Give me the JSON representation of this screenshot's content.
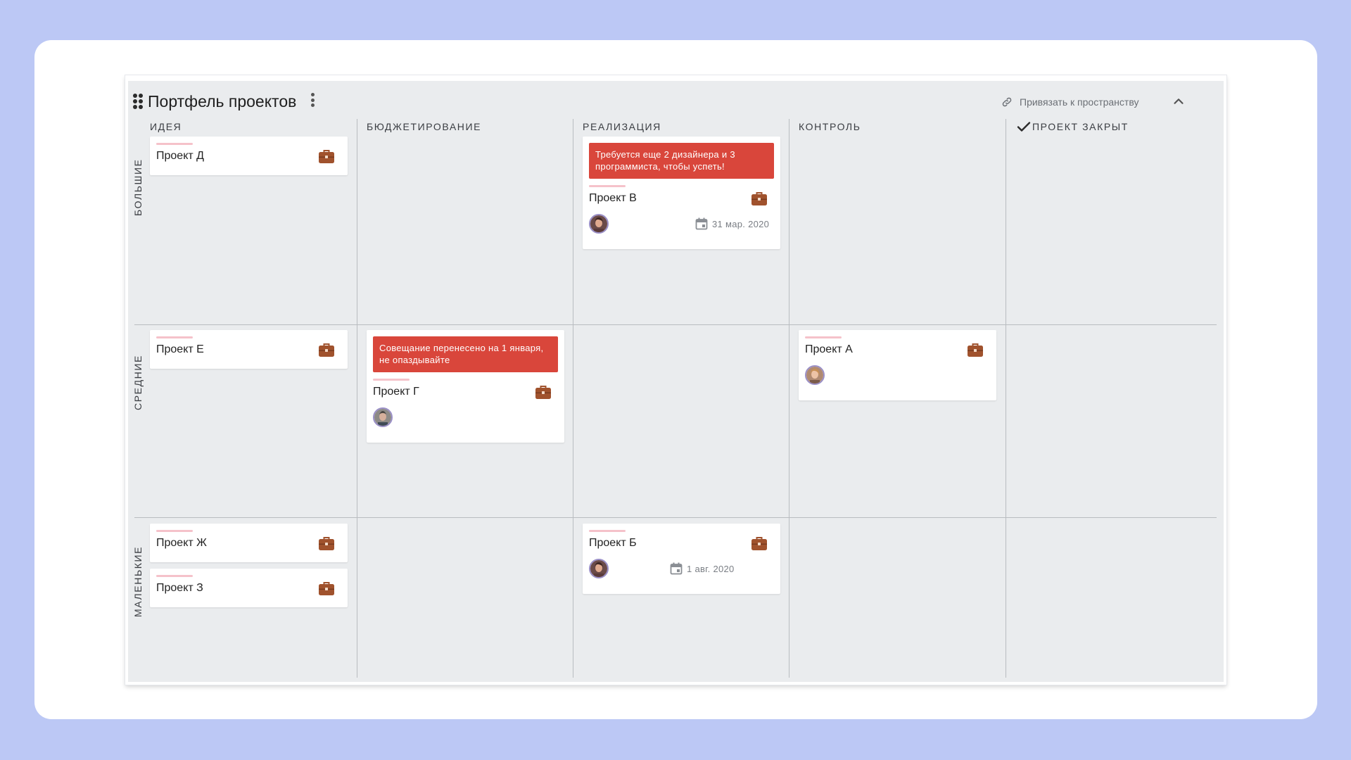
{
  "board": {
    "title": "Портфель проектов",
    "link_label": "Привязать к пространству"
  },
  "columns": [
    {
      "label": "ИДЕЯ"
    },
    {
      "label": "БЮДЖЕТИРОВАНИЕ"
    },
    {
      "label": "РЕАЛИЗАЦИЯ"
    },
    {
      "label": "КОНТРОЛЬ"
    },
    {
      "label": "ПРОЕКТ ЗАКРЫТ",
      "icon": "check-icon"
    }
  ],
  "rows": [
    {
      "label": "БОЛЬШИЕ"
    },
    {
      "label": "СРЕДНИЕ"
    },
    {
      "label": "МАЛЕНЬКИЕ"
    }
  ],
  "cards": {
    "d": {
      "title": "Проект Д"
    },
    "v": {
      "title": "Проект В",
      "alert": "Требуется еще 2 дизайнера и 3 программиста, чтобы успеть!",
      "due": "31 мар. 2020"
    },
    "e": {
      "title": "Проект Е"
    },
    "g": {
      "title": "Проект Г",
      "alert": "Совещание перенесено на 1 января, не опаздывайте"
    },
    "a": {
      "title": "Проект А"
    },
    "zh": {
      "title": "Проект Ж"
    },
    "z": {
      "title": "Проект З"
    },
    "b": {
      "title": "Проект Б",
      "due": "1 авг. 2020"
    }
  },
  "colors": {
    "background": "#bcc8f5",
    "board": "#eaecee",
    "alert": "#d9463b",
    "priority_bar": "#f5c2ca",
    "briefcase": "#a0522d"
  }
}
